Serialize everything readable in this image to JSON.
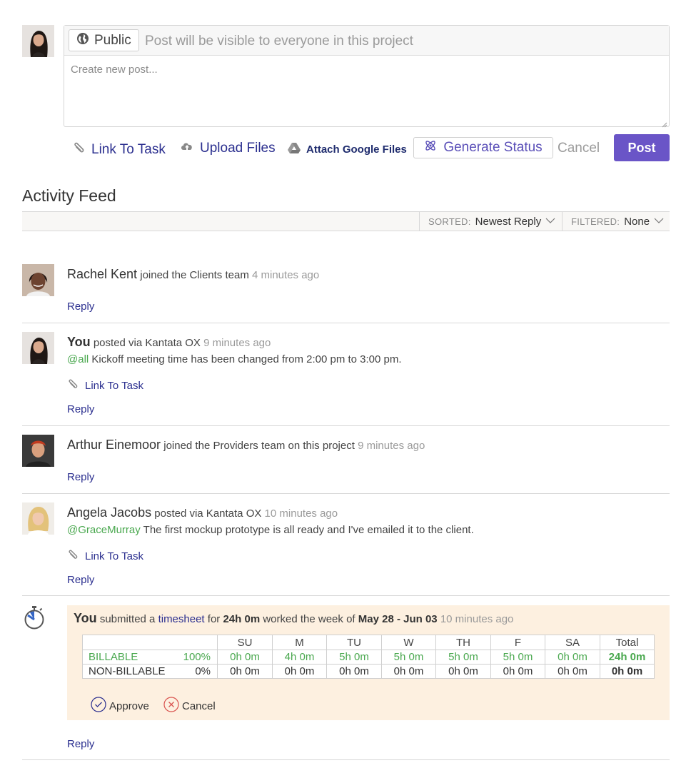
{
  "composer": {
    "visibility_label": "Public",
    "visibility_hint": "Post will be visible to everyone in this project",
    "placeholder": "Create new post...",
    "link_task": "Link To Task",
    "upload_files": "Upload Files",
    "attach_google": "Attach Google Files",
    "generate_status": "Generate Status",
    "cancel": "Cancel",
    "post": "Post"
  },
  "feed": {
    "title": "Activity Feed",
    "sorted_label": "SORTED:",
    "sorted_value": "Newest Reply",
    "filtered_label": "FILTERED:",
    "filtered_value": "None",
    "reply_label": "Reply",
    "link_task_label": "Link To Task",
    "items": [
      {
        "name": "Rachel Kent",
        "action": "joined the Clients team",
        "time": "4 minutes ago"
      },
      {
        "name": "You",
        "action": "posted via Kantata OX",
        "time": "9 minutes ago",
        "mention": "@all",
        "message": "Kickoff meeting time has been changed from 2:00 pm to 3:00 pm."
      },
      {
        "name": "Arthur Einemoor",
        "action": "joined the Providers team on this project",
        "time": "9 minutes ago"
      },
      {
        "name": "Angela Jacobs",
        "action": "posted via Kantata OX",
        "time": "10 minutes ago",
        "mention": "@GraceMurray",
        "message": "The first mockup prototype is all ready and I've emailed it to the client."
      }
    ]
  },
  "timesheet": {
    "who": "You",
    "verb": "submitted a",
    "link": "timesheet",
    "for_text": "for",
    "hours": "24h 0m",
    "week_text": "worked the week of",
    "week": "May 28 - Jun 03",
    "time": "10 minutes ago",
    "days": [
      "SU",
      "M",
      "TU",
      "W",
      "TH",
      "F",
      "SA",
      "Total"
    ],
    "rows": [
      {
        "label": "BILLABLE",
        "pct": "100%",
        "values": [
          "0h 0m",
          "4h 0m",
          "5h 0m",
          "5h 0m",
          "5h 0m",
          "5h 0m",
          "0h 0m"
        ],
        "total": "24h 0m"
      },
      {
        "label": "NON-BILLABLE",
        "pct": "0%",
        "values": [
          "0h 0m",
          "0h 0m",
          "0h 0m",
          "0h 0m",
          "0h 0m",
          "0h 0m",
          "0h 0m"
        ],
        "total": "0h 0m"
      }
    ],
    "approve": "Approve",
    "cancel": "Cancel"
  },
  "colors": {
    "accent": "#6a55c7",
    "link": "#2b2f8f",
    "mention": "#4aa84f",
    "timesheet_bg": "#fdf0e0"
  }
}
